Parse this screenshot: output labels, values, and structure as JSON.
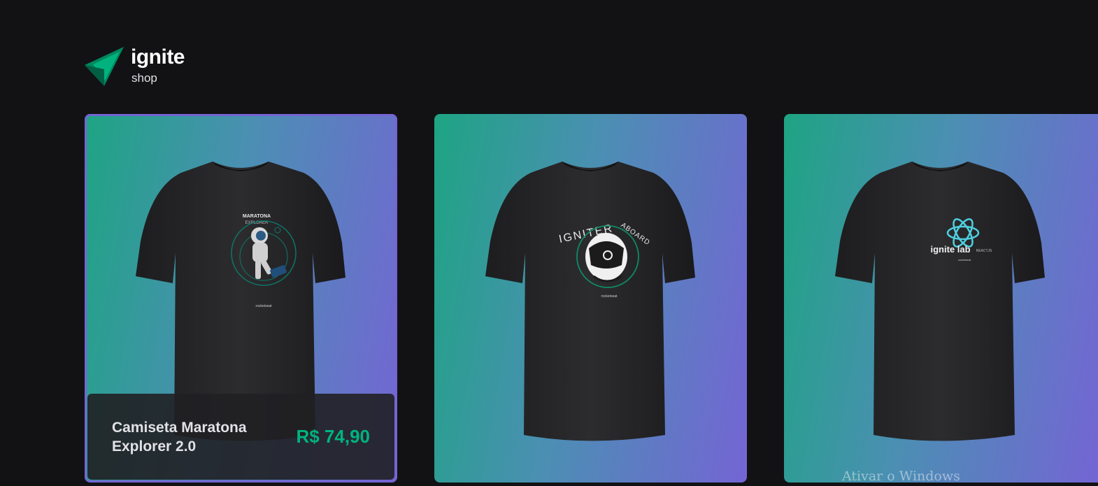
{
  "header": {
    "logo_title": "ignite",
    "logo_subtitle": "shop"
  },
  "colors": {
    "background": "#121214",
    "accent_green": "#00b37e",
    "gradient_start": "#1ea483",
    "gradient_end": "#7465d4"
  },
  "products": [
    {
      "name": "Camiseta Maratona Explorer 2.0",
      "price": "R$ 74,90",
      "print_text_top": "MARATONA",
      "print_text_sub": "EXPLORER",
      "print_icon": "astronaut-icon",
      "brand_mark": "rocketseat",
      "footer_visible": true
    },
    {
      "print_text_top": "IGNITER",
      "print_text_sub": "ABOARD",
      "print_icon": "astronaut-helmet-icon",
      "brand_mark": "rocketseat",
      "footer_visible": false
    },
    {
      "print_text_top": "ignite lab",
      "print_text_sub": "REACTJS",
      "print_icon": "react-atom-icon",
      "brand_mark": "rocketseat",
      "footer_visible": false
    }
  ],
  "system_watermark": "Ativar o Windows"
}
